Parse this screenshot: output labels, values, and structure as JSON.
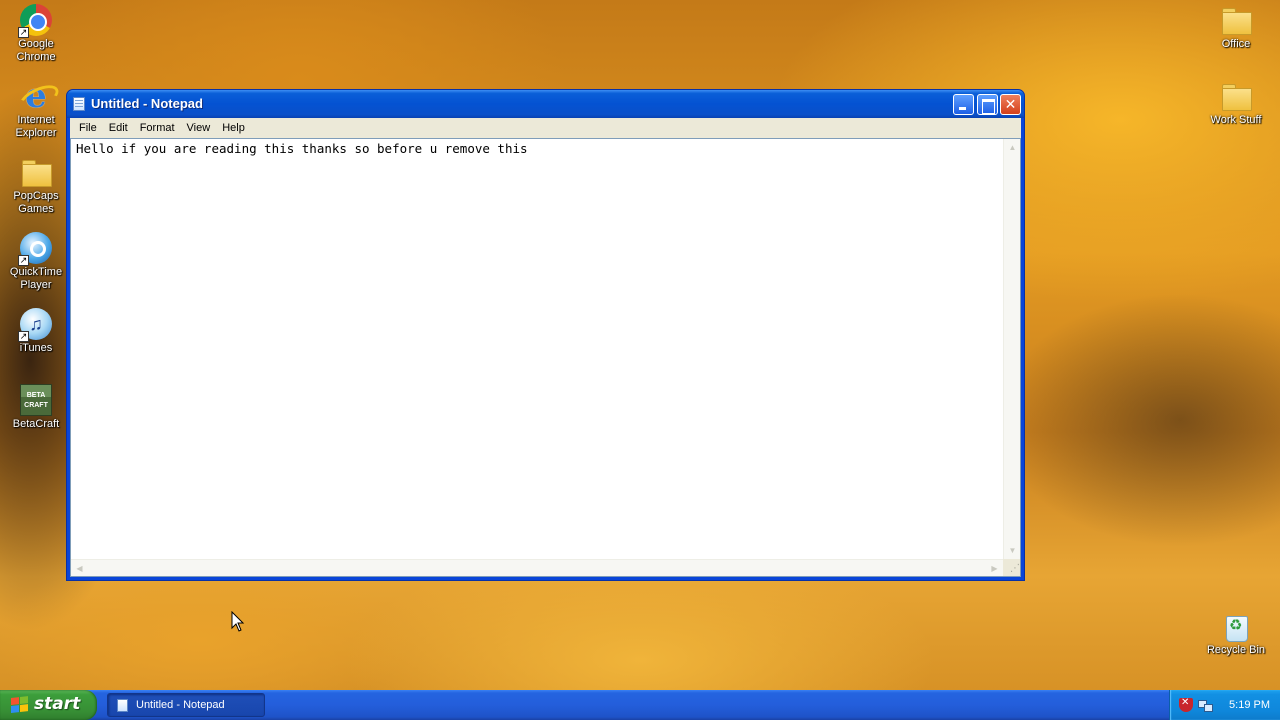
{
  "desktop": {
    "icons_left": [
      {
        "label": "Google Chrome",
        "icon": "chrome-icon",
        "shortcut": true
      },
      {
        "label": "Internet Explorer",
        "icon": "internet-explorer-icon",
        "shortcut": false
      },
      {
        "label": "PopCaps Games",
        "icon": "folder-icon",
        "shortcut": false
      },
      {
        "label": "QuickTime Player",
        "icon": "quicktime-icon",
        "shortcut": true
      },
      {
        "label": "iTunes",
        "icon": "itunes-icon",
        "shortcut": true
      },
      {
        "label": "BetaCraft",
        "icon": "betacraft-icon",
        "shortcut": false
      }
    ],
    "icons_right": [
      {
        "label": "Office",
        "icon": "folder-icon"
      },
      {
        "label": "Work Stuff",
        "icon": "folder-icon"
      },
      {
        "label": "Recycle Bin",
        "icon": "recycle-bin-icon"
      }
    ],
    "beta_logo_text": "BETA CRAFT"
  },
  "notepad": {
    "title": "Untitled - Notepad",
    "menu": [
      "File",
      "Edit",
      "Format",
      "View",
      "Help"
    ],
    "content": "Hello if you are reading this thanks so before u remove this"
  },
  "taskbar": {
    "start_label": "start",
    "tasks": [
      {
        "label": "Untitled - Notepad"
      }
    ],
    "clock": "5:19 PM"
  },
  "colors": {
    "title_bar": "#0452d2",
    "taskbar": "#245edb",
    "start_button": "#378f35",
    "tray": "#0f87db"
  }
}
